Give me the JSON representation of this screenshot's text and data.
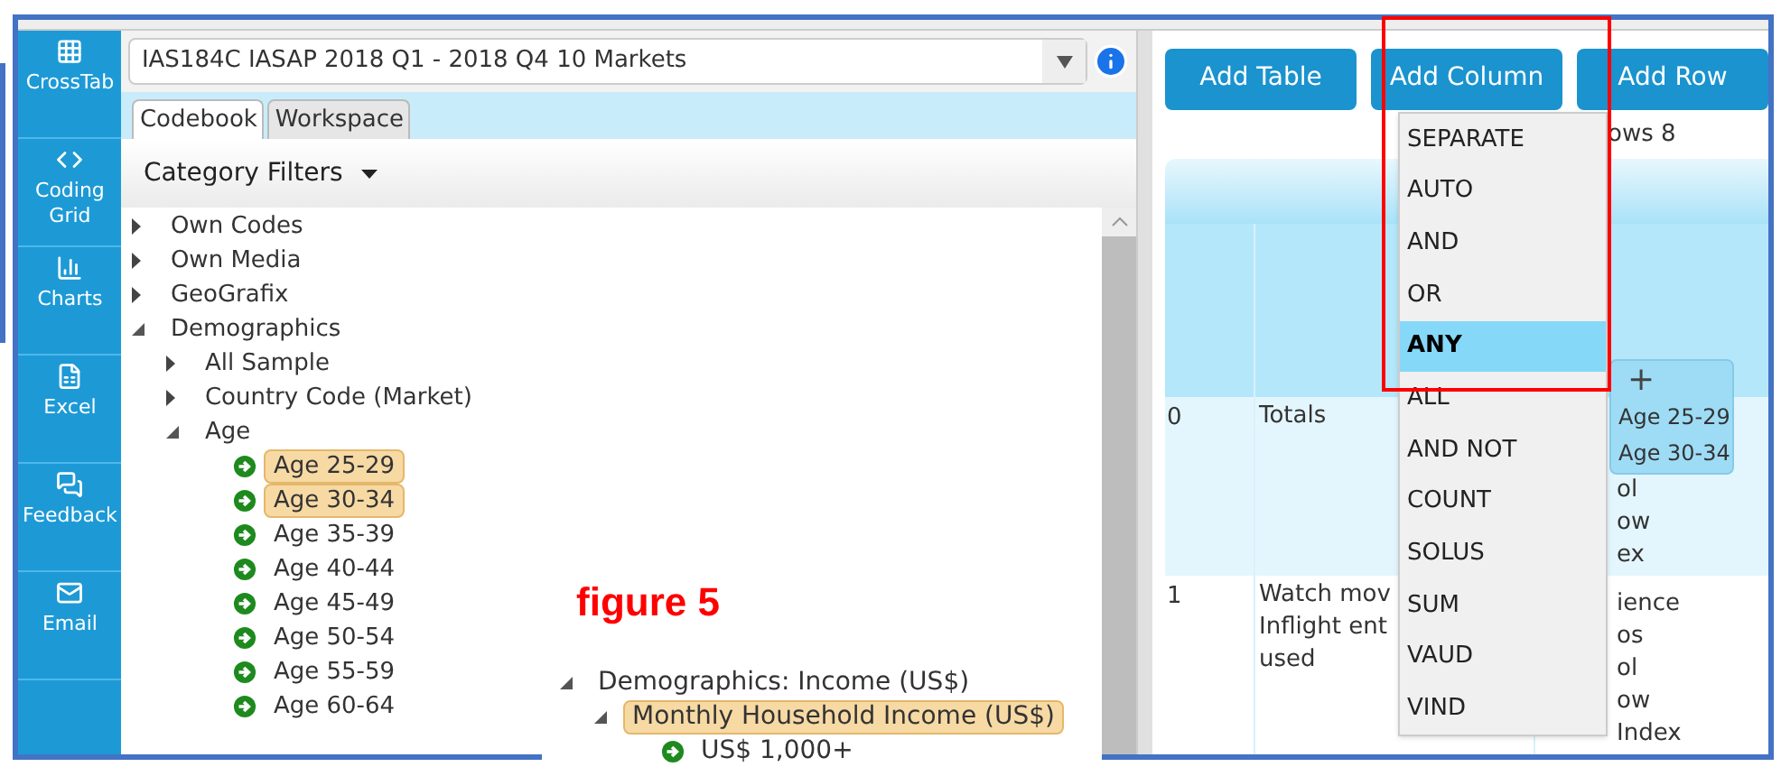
{
  "sidebar": {
    "items": [
      {
        "label": "CrossTab"
      },
      {
        "label": "Coding Grid"
      },
      {
        "label": "Charts"
      },
      {
        "label": "Excel"
      },
      {
        "label": "Feedback"
      },
      {
        "label": "Email"
      }
    ]
  },
  "survey_select": {
    "value": "IAS184C IASAP 2018 Q1 - 2018 Q4 10 Markets"
  },
  "panel_tabs": [
    {
      "label": "Codebook",
      "selected": true
    },
    {
      "label": "Workspace",
      "selected": false
    }
  ],
  "category_filters": {
    "label": "Category Filters"
  },
  "tree": [
    {
      "label": "Own Codes",
      "kind": "folder",
      "expanded": false,
      "selected": false
    },
    {
      "label": "Own Media",
      "kind": "folder",
      "expanded": false,
      "selected": false
    },
    {
      "label": "GeoGrafix",
      "kind": "folder",
      "expanded": false,
      "selected": false
    },
    {
      "label": "Demographics",
      "kind": "folder",
      "expanded": true,
      "selected": false,
      "children": [
        {
          "label": "All Sample",
          "kind": "folder",
          "expanded": false,
          "selected": false
        },
        {
          "label": "Country Code (Market)",
          "kind": "folder",
          "expanded": false,
          "selected": false
        },
        {
          "label": "Age",
          "kind": "folder",
          "expanded": true,
          "selected": false,
          "children": [
            {
              "label": "Age 25-29",
              "kind": "code",
              "selected": true
            },
            {
              "label": "Age 30-34",
              "kind": "code",
              "selected": true
            },
            {
              "label": "Age 35-39",
              "kind": "code",
              "selected": false
            },
            {
              "label": "Age 40-44",
              "kind": "code",
              "selected": false
            },
            {
              "label": "Age 45-49",
              "kind": "code",
              "selected": false
            },
            {
              "label": "Age 50-54",
              "kind": "code",
              "selected": false
            },
            {
              "label": "Age 55-59",
              "kind": "code",
              "selected": false
            },
            {
              "label": "Age 60-64",
              "kind": "code",
              "selected": false
            }
          ]
        }
      ]
    }
  ],
  "figure_label": "figure 5",
  "figure_tree": [
    {
      "label": "Demographics: Income (US$)",
      "kind": "folder",
      "expanded": true,
      "selected": false,
      "children": [
        {
          "label": "Monthly Household Income (US$)",
          "kind": "folder",
          "expanded": true,
          "selected": true,
          "children": [
            {
              "label": "US$ 1,000+",
              "kind": "code",
              "selected": false
            }
          ]
        }
      ]
    }
  ],
  "toolbar_buttons": [
    "Add Table",
    "Add Column",
    "Add Row"
  ],
  "table_info": "ows 8",
  "table": {
    "rows": [
      {
        "number": "0",
        "label": [
          "Totals"
        ],
        "stats": [
          "ol",
          "ow",
          "ex"
        ]
      },
      {
        "number": "1",
        "label": [
          "Watch mov",
          "Inflight ent",
          "used"
        ],
        "stats": [
          "ience",
          "os",
          "ol",
          "ow",
          "Index"
        ]
      }
    ]
  },
  "column_menu": {
    "items": [
      {
        "label": "SEPARATE",
        "selected": false
      },
      {
        "label": "AUTO",
        "selected": false
      },
      {
        "label": "AND",
        "selected": false
      },
      {
        "label": "OR",
        "selected": false
      },
      {
        "label": "ANY",
        "selected": true
      },
      {
        "label": "ALL",
        "selected": false
      },
      {
        "label": "AND NOT",
        "selected": false
      },
      {
        "label": "COUNT",
        "selected": false
      },
      {
        "label": "SOLUS",
        "selected": false
      },
      {
        "label": "SUM",
        "selected": false
      },
      {
        "label": "VAUD",
        "selected": false
      },
      {
        "label": "VIND",
        "selected": false
      }
    ]
  },
  "drag_tooltip": {
    "symbol": "+",
    "items": [
      "Age 25-29",
      "Age 30-34"
    ]
  }
}
